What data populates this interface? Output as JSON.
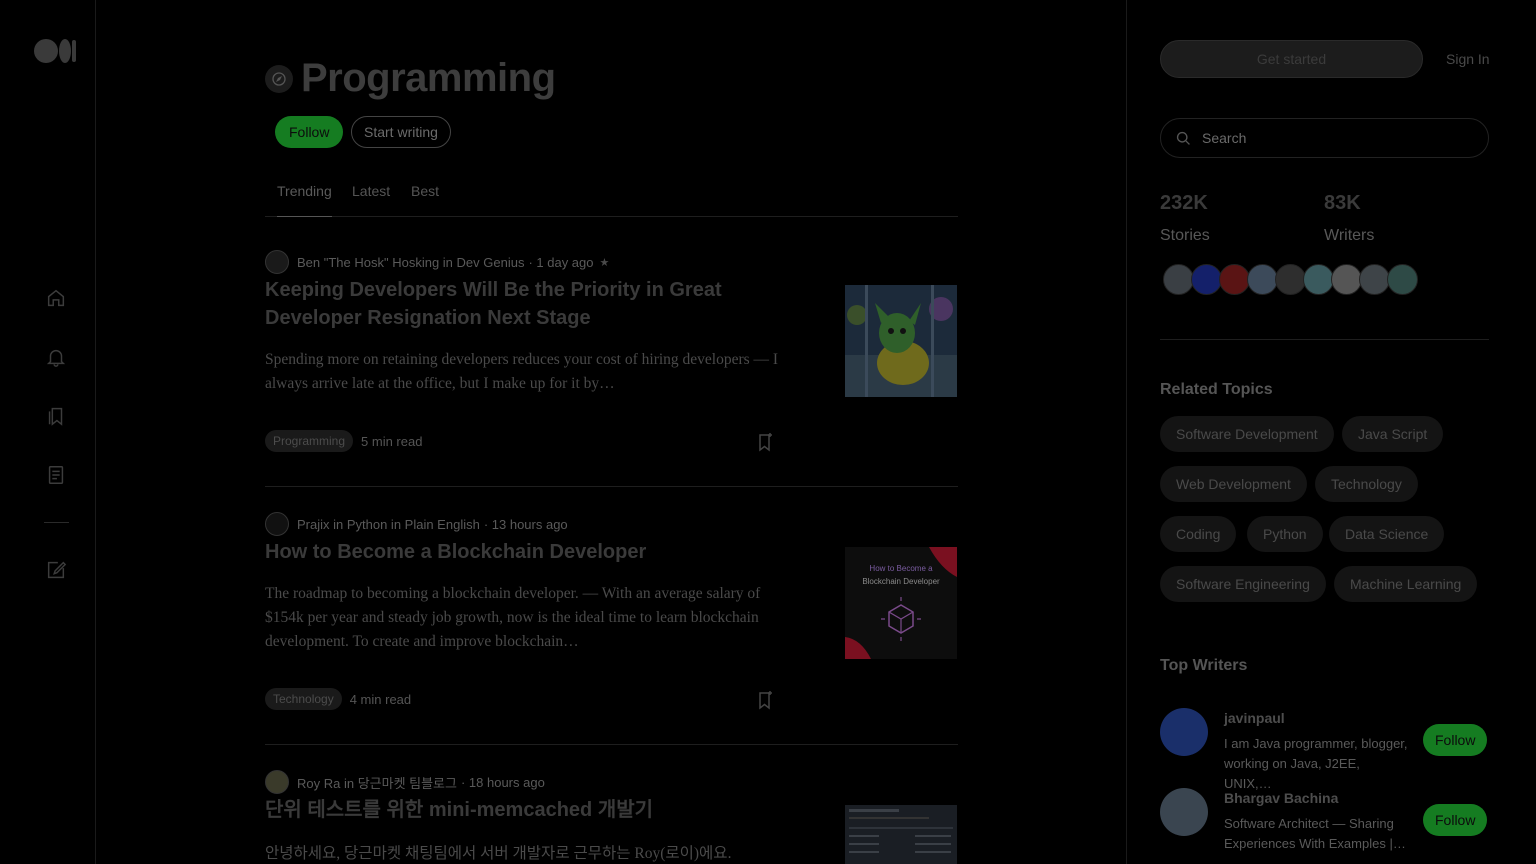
{
  "topic": {
    "title": "Programming",
    "follow_label": "Follow",
    "start_writing_label": "Start writing"
  },
  "tabs": [
    {
      "label": "Trending",
      "active": true
    },
    {
      "label": "Latest",
      "active": false
    },
    {
      "label": "Best",
      "active": false
    }
  ],
  "articles": [
    {
      "author": "Ben \"The Hosk\" Hosking in Dev Genius",
      "time": "· 1 day ago",
      "member_only": true,
      "title": "Keeping Developers Will Be the Priority in Great Developer Resignation Next Stage",
      "subtitle": "Spending more on retaining developers reduces your cost of hiring developers — I always arrive late at the office, but I make up for it by…",
      "tag": "Programming",
      "read_time": "5 min read"
    },
    {
      "author": "Prajix in Python in Plain English",
      "time": "· 13 hours ago",
      "member_only": false,
      "title": "How to Become a Blockchain Developer",
      "subtitle": "The roadmap to becoming a blockchain developer. — With an average salary of $154k per year and steady job growth, now is the ideal time to learn blockchain development. To create and improve blockchain…",
      "tag": "Technology",
      "read_time": "4 min read",
      "thumb_text": [
        "How to Become a",
        "Blockchain Developer"
      ]
    },
    {
      "author": "Roy Ra in 당근마켓 팀블로그",
      "time": "· 18 hours ago",
      "member_only": false,
      "title": "단위 테스트를 위한 mini-memcached 개발기",
      "subtitle": "안녕하세요, 당근마켓 채팅팀에서 서버 개발자로 근무하는 Roy(로이)에요."
    }
  ],
  "header": {
    "get_started_label": "Get started",
    "sign_in_label": "Sign In"
  },
  "search": {
    "placeholder": "Search"
  },
  "stats": {
    "stories_count": "232K",
    "stories_label": "Stories",
    "writers_count": "83K",
    "writers_label": "Writers"
  },
  "related_topics": {
    "heading": "Related Topics",
    "items": [
      "Software Development",
      "Java Script",
      "Web Development",
      "Technology",
      "Coding",
      "Python",
      "Data Science",
      "Software Engineering",
      "Machine Learning"
    ]
  },
  "top_writers": {
    "heading": "Top Writers",
    "items": [
      {
        "name": "javinpaul",
        "bio": "I am Java programmer, blogger, working on Java, J2EE, UNIX,…",
        "follow_label": "Follow"
      },
      {
        "name": "Bhargav Bachina",
        "bio": "Software Architect — Sharing Experiences With Examples |…",
        "follow_label": "Follow"
      }
    ]
  },
  "colors": {
    "background": "#000000",
    "accent_green": "#157c21",
    "text_dim": "#3a3a3a"
  }
}
